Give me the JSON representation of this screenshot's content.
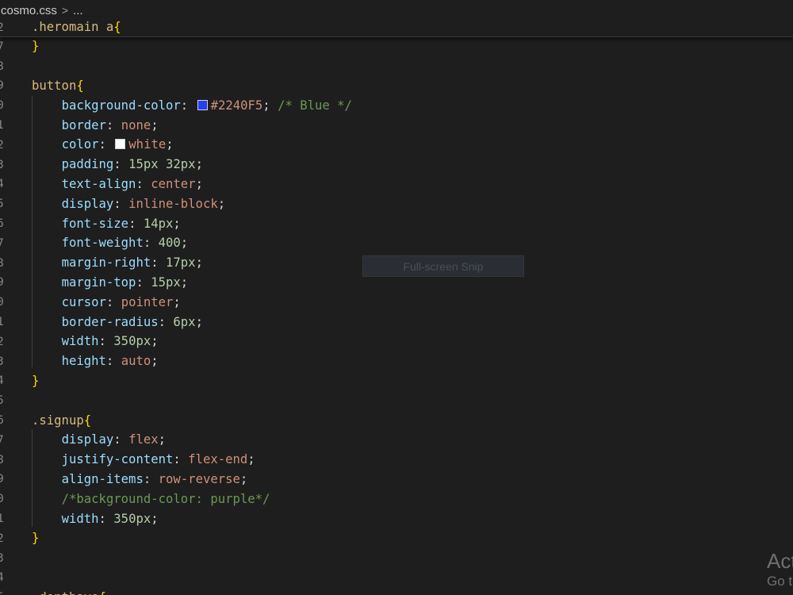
{
  "breadcrumb": {
    "file": "cosmo.css",
    "separator": ">",
    "more": "..."
  },
  "colors": {
    "blue_swatch": "#2240F5",
    "white_swatch": "#FFFFFF",
    "background": "#1e1e1e"
  },
  "sticky": {
    "line_number": "2",
    "selector": ".heromain a",
    "brace": "{"
  },
  "lines": [
    {
      "n": "7",
      "brace": "}"
    },
    {
      "n": "8"
    },
    {
      "n": "9",
      "selector": "button",
      "brace": "{"
    },
    {
      "n": "0",
      "prop": "background-color",
      "swatch": "blue",
      "value": "#2240F5",
      "semi": ";",
      "comment": "/* Blue */"
    },
    {
      "n": "1",
      "prop": "border",
      "value": "none",
      "semi": ";"
    },
    {
      "n": "2",
      "prop": "color",
      "swatch": "white",
      "value": "white",
      "semi": ";"
    },
    {
      "n": "3",
      "prop": "padding",
      "value": "15px 32px",
      "semi": ";"
    },
    {
      "n": "4",
      "prop": "text-align",
      "value": "center",
      "semi": ";"
    },
    {
      "n": "5",
      "prop": "display",
      "value": "inline-block",
      "semi": ";"
    },
    {
      "n": "6",
      "prop": "font-size",
      "value": "14px",
      "semi": ";"
    },
    {
      "n": "7",
      "prop": "font-weight",
      "value": "400",
      "semi": ";"
    },
    {
      "n": "8",
      "prop": "margin-right",
      "value": "17px",
      "semi": ";"
    },
    {
      "n": "9",
      "prop": "margin-top",
      "value": "15px",
      "semi": ";"
    },
    {
      "n": "0",
      "prop": "cursor",
      "value": "pointer",
      "semi": ";"
    },
    {
      "n": "1",
      "prop": "border-radius",
      "value": "6px",
      "semi": ";"
    },
    {
      "n": "2",
      "prop": "width",
      "value": "350px",
      "semi": ";"
    },
    {
      "n": "3",
      "prop": "height",
      "value": "auto",
      "semi": ";"
    },
    {
      "n": "4",
      "brace": "}"
    },
    {
      "n": "5"
    },
    {
      "n": "6",
      "selector": ".signup",
      "brace": "{"
    },
    {
      "n": "7",
      "prop": "display",
      "value": "flex",
      "semi": ";"
    },
    {
      "n": "8",
      "prop": "justify-content",
      "value": "flex-end",
      "semi": ";"
    },
    {
      "n": "9",
      "prop": "align-items",
      "value": "row-reverse",
      "semi": ";"
    },
    {
      "n": "0",
      "comment": "/*background-color: purple*/"
    },
    {
      "n": "1",
      "prop": "width",
      "value": "350px",
      "semi": ";"
    },
    {
      "n": "2",
      "brace": "}"
    },
    {
      "n": "3"
    },
    {
      "n": "4"
    },
    {
      "n": "5",
      "selector": ".donthave",
      "brace": "{"
    }
  ],
  "overlay": {
    "snip_tooltip": "Full-screen Snip"
  },
  "watermark": {
    "line1": "Act",
    "line2": "Go t"
  }
}
